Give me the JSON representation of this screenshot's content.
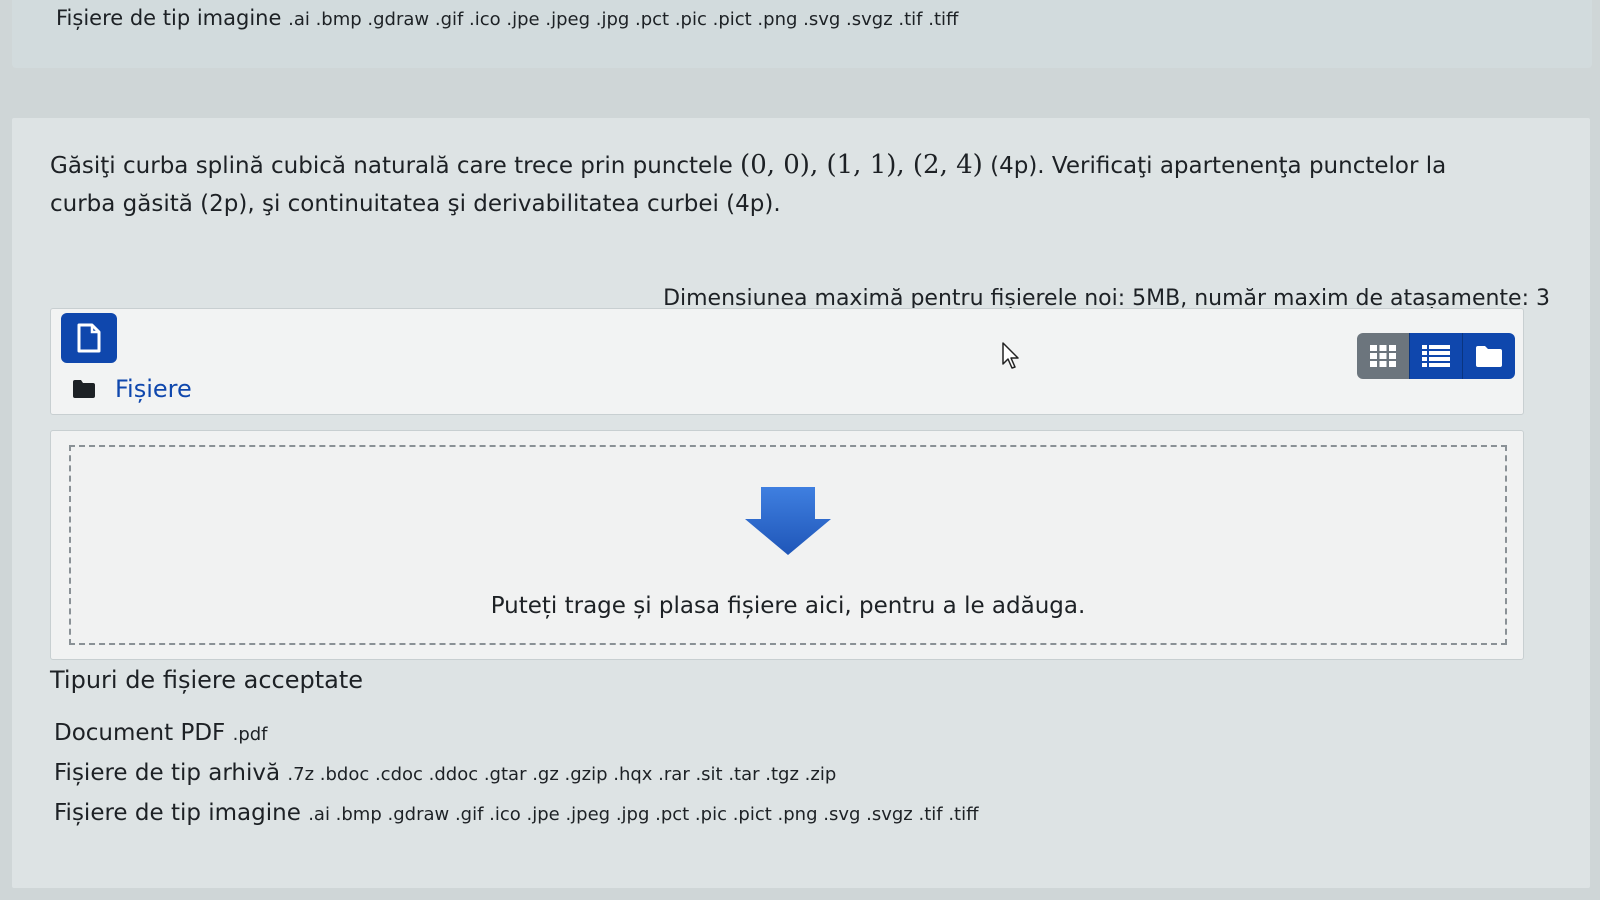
{
  "top_row": {
    "label": "Fișiere de tip imagine",
    "extensions": ".ai .bmp .gdraw .gif .ico .jpe .jpeg .jpg .pct .pic .pict .png .svg .svgz .tif .tiff"
  },
  "question": {
    "text_before": "Găsiţi curba splină cubică naturală care trece prin punctele",
    "points_math": "(0, 0), (1, 1), (2, 4)",
    "text_after": "(4p). Verificaţi apartenenţa punctelor la curba găsită (2p), şi continuitatea şi derivabilitatea curbei (4p)."
  },
  "filemanager": {
    "limits_note": "Dimensiunea maximă pentru fișierele noi: 5MB, număr maxim de atașamente: 3",
    "folder_label": "Fișiere",
    "drop_text": "Puteți trage și plasa fișiere aici, pentru a le adăuga.",
    "add_icon": "file-icon",
    "views": [
      "grid-view-icon",
      "list-view-icon",
      "folder-view-icon"
    ],
    "active_view": "list-view-icon"
  },
  "accepted_types": {
    "title": "Tipuri de fișiere acceptate",
    "items": [
      {
        "label": "Document PDF",
        "extensions": ".pdf"
      },
      {
        "label": "Fișiere de tip arhivă",
        "extensions": ".7z .bdoc .cdoc .ddoc .gtar .gz .gzip .hqx .rar .sit .tar .tgz .zip"
      },
      {
        "label": "Fișiere de tip imagine",
        "extensions": ".ai .bmp .gdraw .gif .ico .jpe .jpeg .jpg .pct .pic .pict .png .svg .svgz .tif .tiff"
      }
    ]
  },
  "colors": {
    "primary": "#0f47ad",
    "secondary": "#6c757d",
    "drop_arrow": "#2d6bd1"
  }
}
